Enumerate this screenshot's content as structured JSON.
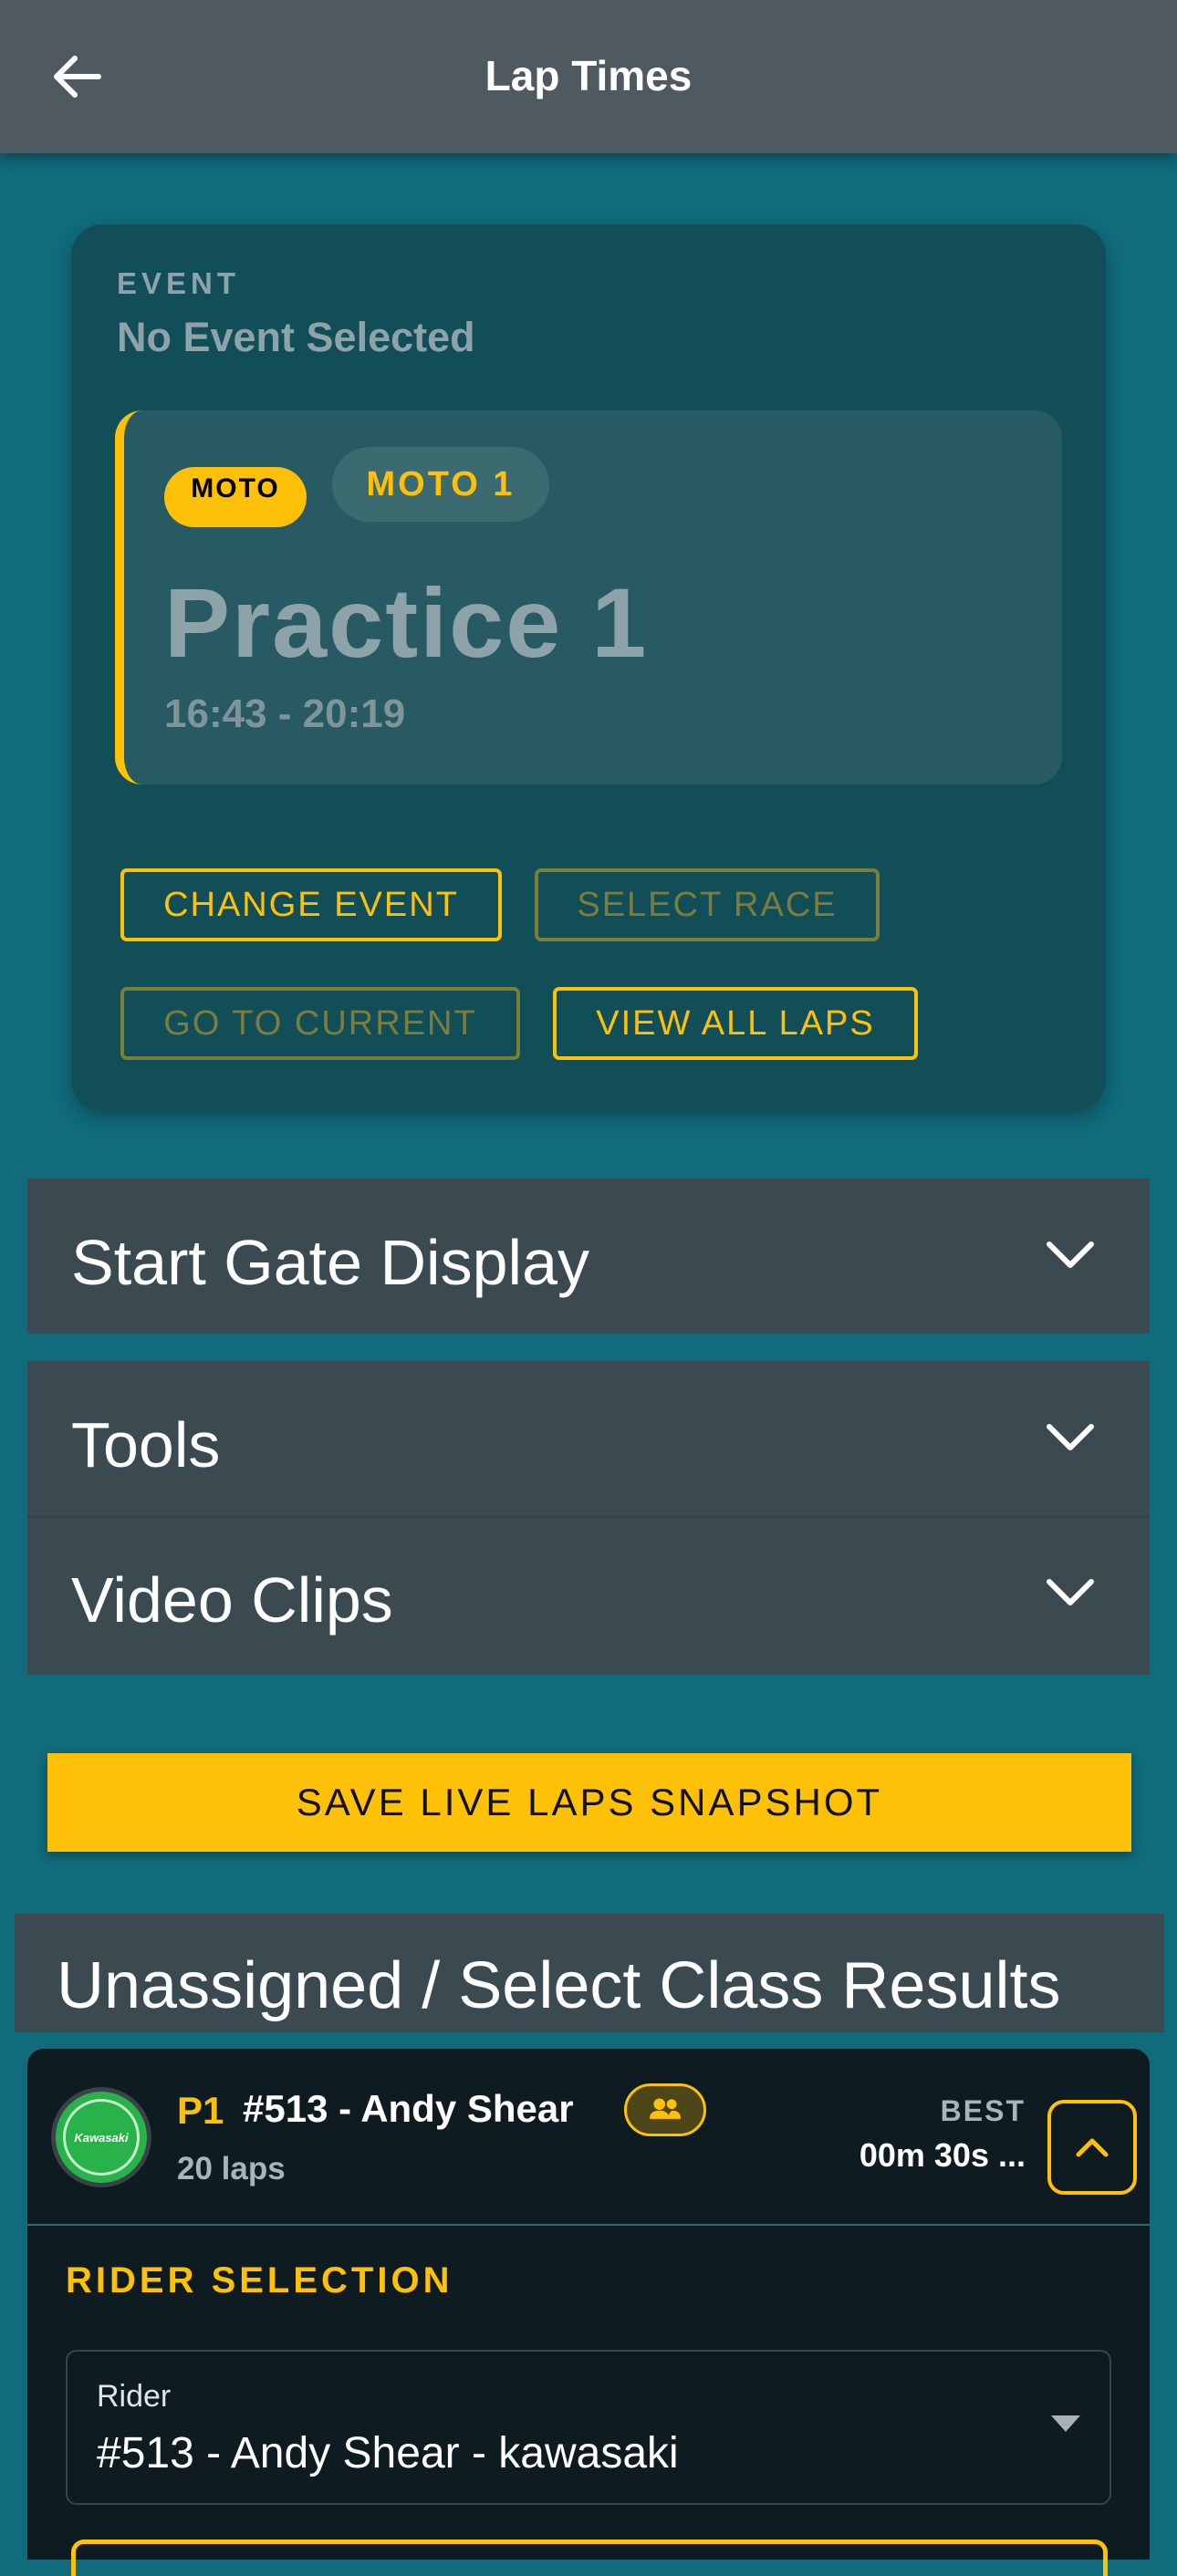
{
  "appbar": {
    "title": "Lap Times",
    "back_icon": "arrow-left-icon"
  },
  "event": {
    "label": "EVENT",
    "value": "No Event Selected",
    "race": {
      "type_badge": "MOTO",
      "moto_badge": "MOTO 1",
      "name": "Practice 1",
      "time": "16:43 - 20:19",
      "accent_color": "#ffc107"
    },
    "buttons": {
      "change_event": "CHANGE EVENT",
      "select_race": "SELECT RACE",
      "go_to_current": "GO TO CURRENT",
      "view_all_laps": "VIEW ALL LAPS"
    }
  },
  "sections": {
    "start_gate": "Start Gate Display",
    "tools": "Tools",
    "video_clips": "Video Clips"
  },
  "save_button": "SAVE LIVE LAPS SNAPSHOT",
  "results": {
    "header": "Unassigned / Select Class Results",
    "rider": {
      "position": "P1",
      "name": "#513 - Andy Shear",
      "laps": "20 laps",
      "best_label": "BEST",
      "best_value": "00m 30s ...",
      "logo_text": "Kawasaki",
      "group_icon": "people-icon"
    },
    "selection": {
      "title": "RIDER SELECTION",
      "field_label": "Rider",
      "field_value": "#513 - Andy Shear - kawasaki"
    }
  },
  "colors": {
    "background": "#106b7a",
    "appbar": "#4e5a60",
    "accent": "#ffc107",
    "card": "#124e58",
    "accordion": "#3b4951"
  }
}
